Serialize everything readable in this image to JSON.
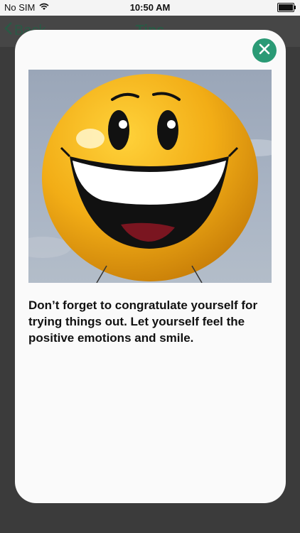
{
  "status_bar": {
    "carrier": "No SIM",
    "time": "10:50 AM"
  },
  "nav": {
    "back_label": "Back",
    "title": "Tips"
  },
  "modal": {
    "tip_text": "Don’t forget to congratulate yourself for trying things out. Let yourself feel the positive emotions and smile.",
    "image_subject": "smiley-face-balloon",
    "close_icon": "close-icon",
    "accent_color": "#2a9a75"
  }
}
